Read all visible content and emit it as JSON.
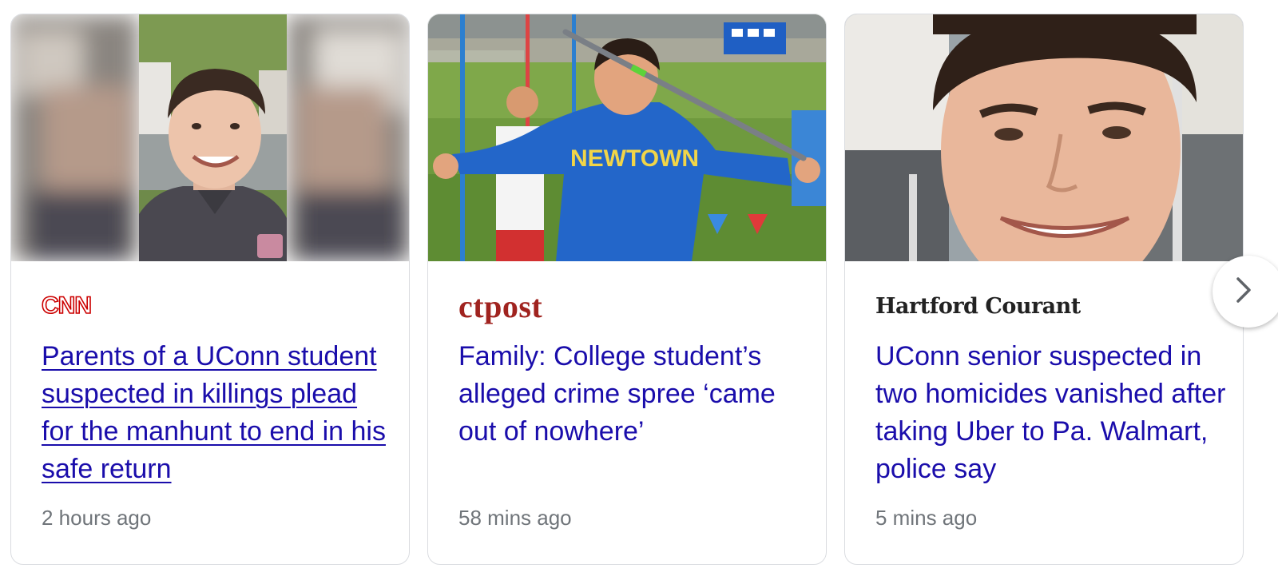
{
  "articles": [
    {
      "source": "CNN",
      "headline": "Parents of a UConn student suspected in killings plead for the manhunt to end in his safe return",
      "time": "2 hours ago",
      "image": "portrait-young-man-smiling"
    },
    {
      "source": "ctpost",
      "headline": "Family: College student’s alleged crime spree ‘came out of nowhere’",
      "time": "58 mins ago",
      "image": "javelin-thrower-newtown-shirt",
      "shirt_text": "NEWTOWN"
    },
    {
      "source": "Hartford Courant",
      "headline": "UConn senior suspected in two homicides vanished after taking Uber to Pa. Walmart, police say",
      "time": "5 mins ago",
      "image": "closeup-smiling-young-man"
    }
  ],
  "next_button_icon": "chevron-right-icon",
  "colors": {
    "link": "#1a0dab",
    "meta": "#70757a",
    "border": "#dadce0",
    "cnn_red": "#cc0000",
    "ctpost_red": "#a0231f"
  }
}
